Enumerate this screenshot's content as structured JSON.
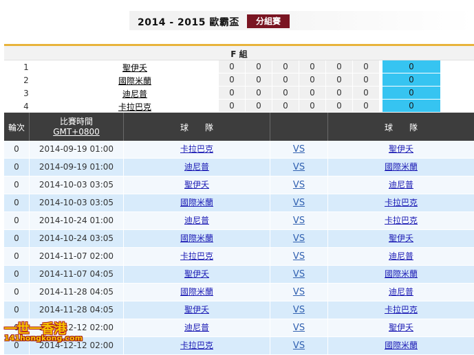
{
  "header": {
    "season_title": "2014 - 2015 歐霸盃",
    "stage_button": "分組賽"
  },
  "group": {
    "title": "F 組",
    "standings": [
      {
        "rank": "1",
        "team": "聖伊夭",
        "stats": [
          "0",
          "0",
          "0",
          "0",
          "0",
          "0"
        ],
        "points": "0"
      },
      {
        "rank": "2",
        "team": "國際米蘭",
        "stats": [
          "0",
          "0",
          "0",
          "0",
          "0",
          "0"
        ],
        "points": "0"
      },
      {
        "rank": "3",
        "team": "迪尼普",
        "stats": [
          "0",
          "0",
          "0",
          "0",
          "0",
          "0"
        ],
        "points": "0"
      },
      {
        "rank": "4",
        "team": "卡拉巴克",
        "stats": [
          "0",
          "0",
          "0",
          "0",
          "0",
          "0"
        ],
        "points": "0"
      }
    ]
  },
  "fixtures": {
    "headers": {
      "round": "輪次",
      "time_line1": "比賽時間",
      "time_line2": "GMT+0800",
      "home": "球　　隊",
      "vs": "",
      "away": "球　　隊"
    },
    "rows": [
      {
        "round": "0",
        "time": "2014-09-19 01:00",
        "home": "卡拉巴克",
        "vs": "VS",
        "away": "聖伊夭"
      },
      {
        "round": "0",
        "time": "2014-09-19 01:00",
        "home": "迪尼普",
        "vs": "VS",
        "away": "國際米蘭"
      },
      {
        "round": "0",
        "time": "2014-10-03 03:05",
        "home": "聖伊夭",
        "vs": "VS",
        "away": "迪尼普"
      },
      {
        "round": "0",
        "time": "2014-10-03 03:05",
        "home": "國際米蘭",
        "vs": "VS",
        "away": "卡拉巴克"
      },
      {
        "round": "0",
        "time": "2014-10-24 01:00",
        "home": "迪尼普",
        "vs": "VS",
        "away": "卡拉巴克"
      },
      {
        "round": "0",
        "time": "2014-10-24 03:05",
        "home": "國際米蘭",
        "vs": "VS",
        "away": "聖伊夭"
      },
      {
        "round": "0",
        "time": "2014-11-07 02:00",
        "home": "卡拉巴克",
        "vs": "VS",
        "away": "迪尼普"
      },
      {
        "round": "0",
        "time": "2014-11-07 04:05",
        "home": "聖伊夭",
        "vs": "VS",
        "away": "國際米蘭"
      },
      {
        "round": "0",
        "time": "2014-11-28 04:05",
        "home": "國際米蘭",
        "vs": "VS",
        "away": "迪尼普"
      },
      {
        "round": "0",
        "time": "2014-11-28 04:05",
        "home": "聖伊夭",
        "vs": "VS",
        "away": "卡拉巴克"
      },
      {
        "round": "0",
        "time": "2014-12-12 02:00",
        "home": "迪尼普",
        "vs": "VS",
        "away": "聖伊夭"
      },
      {
        "round": "0",
        "time": "2014-12-12 02:00",
        "home": "卡拉巴克",
        "vs": "VS",
        "away": "國際米蘭"
      }
    ]
  },
  "watermark": {
    "chinese": "一世一香港",
    "english": "141hongkong.com"
  },
  "colors": {
    "stage_button_bg": "#7a1522",
    "accent_rule": "#e8b33a",
    "points_bg": "#36c4f1",
    "header_bg": "#3d3d3d",
    "row_odd": "#f3f8fd",
    "row_even": "#d8ebfb",
    "link": "#1a1ab4"
  }
}
